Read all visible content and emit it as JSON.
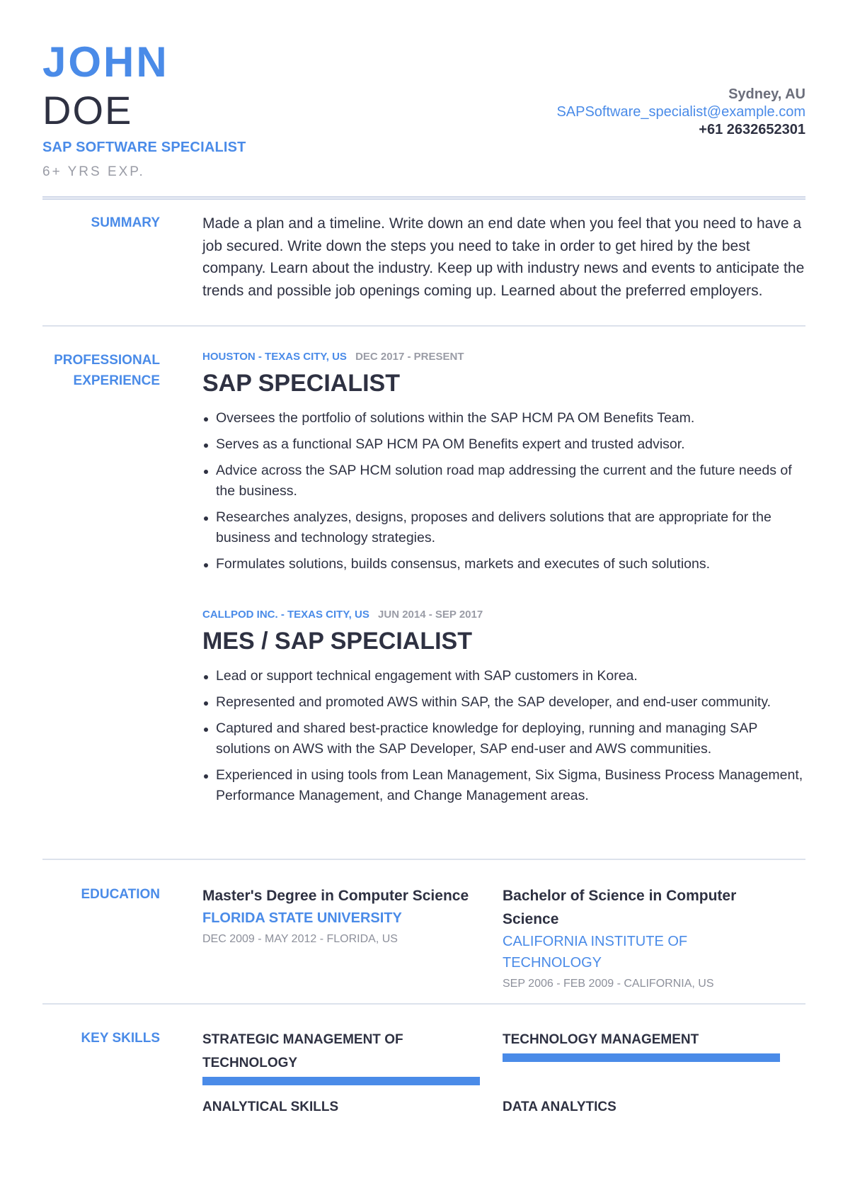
{
  "header": {
    "first_name": "JOHN",
    "last_name": "DOE",
    "job_title": "SAP SOFTWARE SPECIALIST",
    "experience": "6+ YRS EXP.",
    "contact": {
      "location": "Sydney, AU",
      "email": "SAPSoftware_specialist@example.com",
      "phone": "+61 2632652301"
    }
  },
  "colors": {
    "accent": "#4a8be8",
    "text": "#2e3142",
    "muted": "#9a9ca6",
    "rule": "#dce2ec"
  },
  "summary": {
    "label": "SUMMARY",
    "text": "Made a plan and a timeline. Write down an end date when you feel that you need to have a job secured. Write down the steps you need to take in order to get hired by the best company. Learn about the industry. Keep up with industry news and events to anticipate the trends and possible job openings coming up. Learned about the preferred employers."
  },
  "experience": {
    "label_line1": "PROFESSIONAL",
    "label_line2": "EXPERIENCE",
    "jobs": [
      {
        "company": "HOUSTON - TEXAS CITY, US",
        "dates": "DEC 2017 - PRESENT",
        "role": "SAP SPECIALIST",
        "bullets": [
          "Oversees the portfolio of solutions within the SAP HCM PA OM Benefits Team.",
          "Serves as a functional SAP HCM PA OM Benefits expert and trusted advisor.",
          "Advice across the SAP HCM solution road map addressing the current and the future needs of the business.",
          "Researches analyzes, designs, proposes and delivers solutions that are appropriate for the business and technology strategies.",
          "Formulates solutions, builds consensus, markets and executes of such solutions."
        ]
      },
      {
        "company": "CALLPOD INC. - TEXAS CITY, US",
        "dates": "JUN 2014 - SEP 2017",
        "role": "MES / SAP SPECIALIST",
        "bullets": [
          "Lead or support technical engagement with SAP customers in Korea.",
          "Represented and promoted AWS within SAP, the SAP developer, and end-user community.",
          "Captured and shared best-practice knowledge for deploying, running and managing SAP solutions on AWS with the SAP Developer, SAP end-user and AWS communities.",
          "Experienced in using tools from Lean Management, Six Sigma, Business Process Management, Performance Management, and Change Management areas."
        ]
      }
    ]
  },
  "education": {
    "label": "EDUCATION",
    "items": [
      {
        "degree": "Master's Degree in Computer Science",
        "school": "FLORIDA STATE UNIVERSITY",
        "details": "DEC 2009 - MAY 2012 - FLORIDA, US"
      },
      {
        "degree": "Bachelor of Science in Computer Science",
        "school": "CALIFORNIA INSTITUTE OF TECHNOLOGY",
        "details": "SEP 2006 - FEB 2009 - CALIFORNIA, US"
      }
    ]
  },
  "skills": {
    "label": "KEY SKILLS",
    "items": [
      {
        "name": "STRATEGIC MANAGEMENT OF TECHNOLOGY",
        "level_percent": 100
      },
      {
        "name": "TECHNOLOGY MANAGEMENT",
        "level_percent": 100
      },
      {
        "name": "ANALYTICAL SKILLS",
        "level_percent": null
      },
      {
        "name": "DATA ANALYTICS",
        "level_percent": null
      }
    ]
  }
}
